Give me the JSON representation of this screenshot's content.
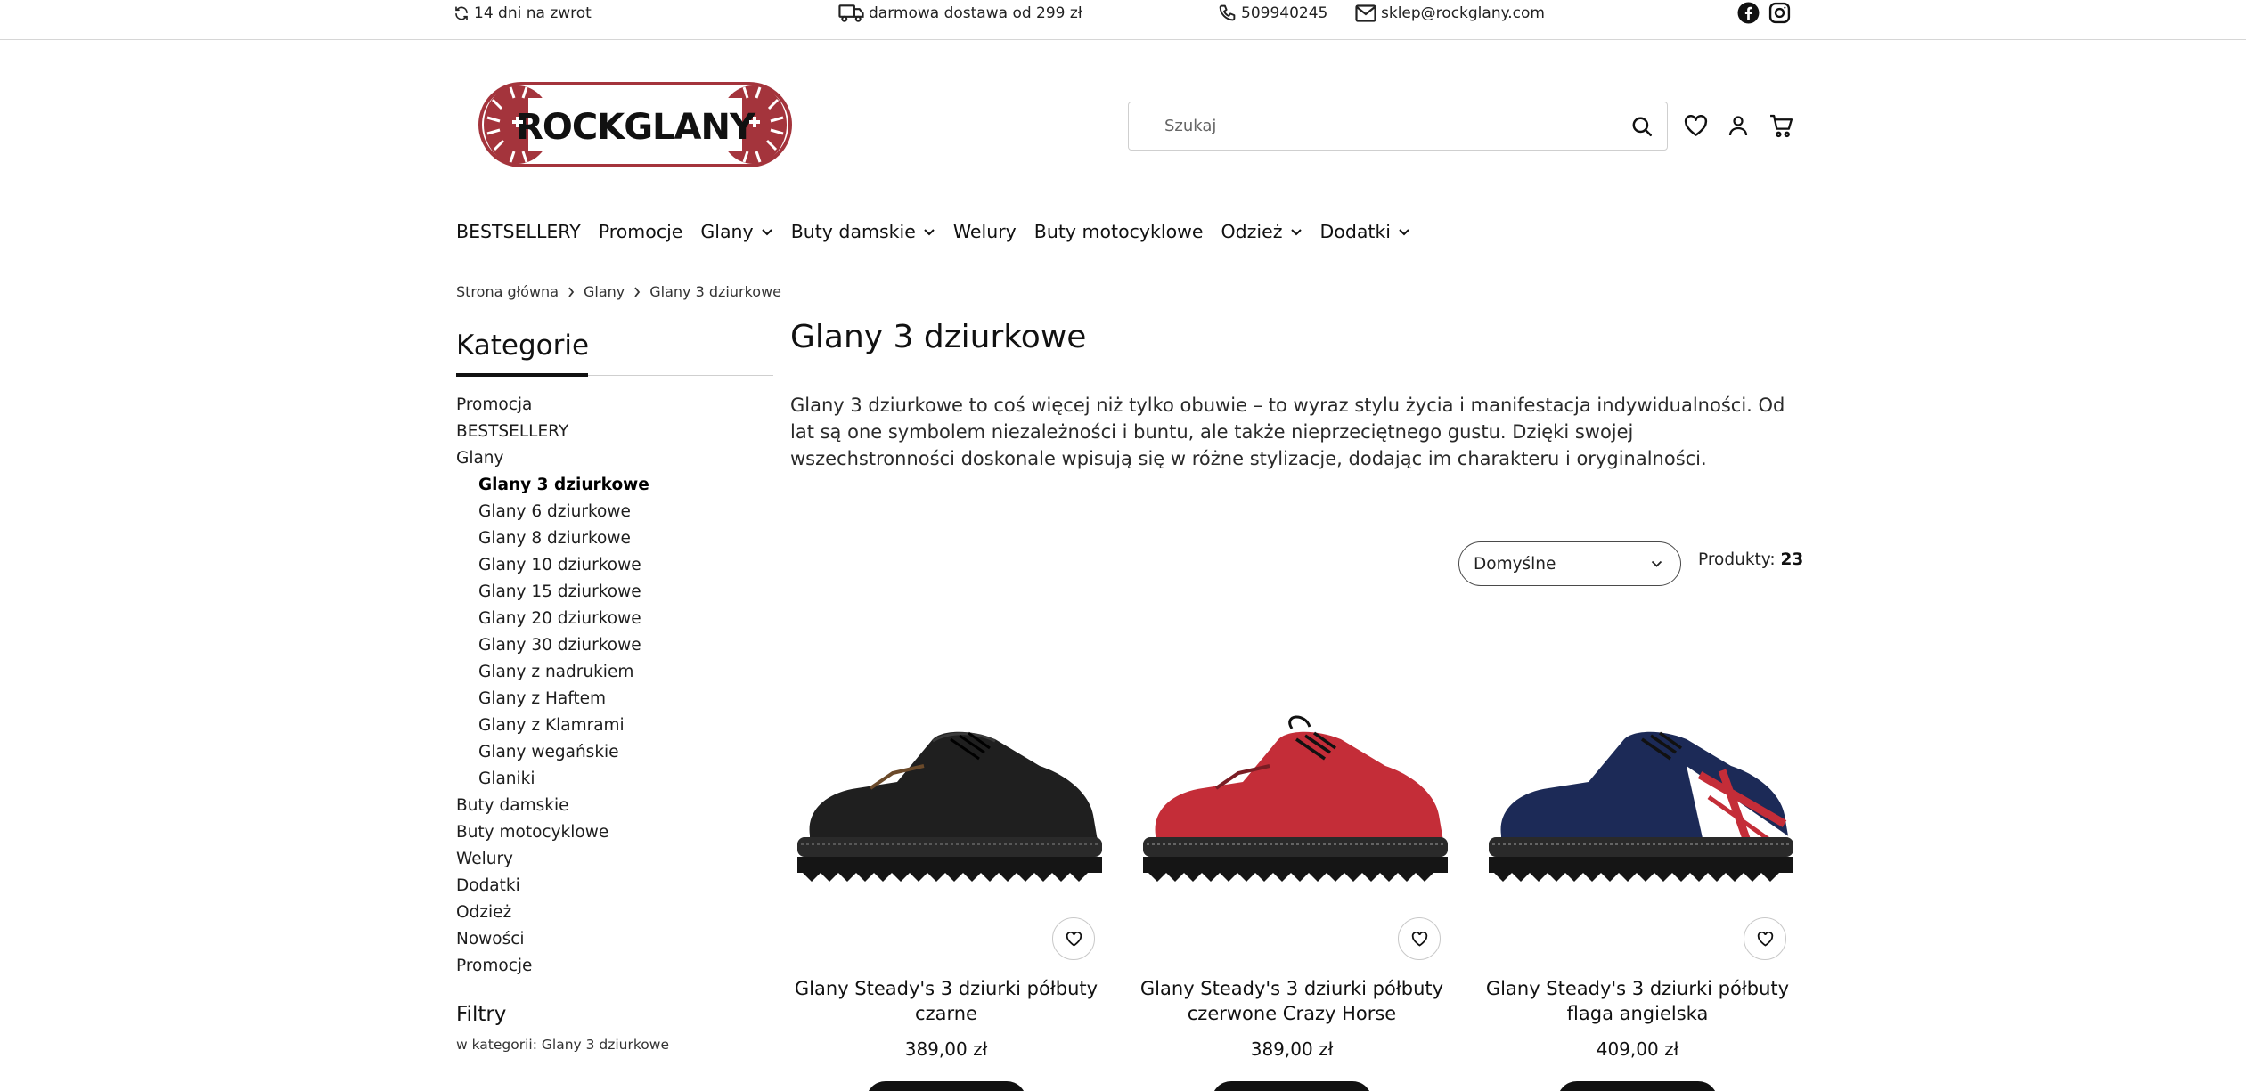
{
  "topbar": {
    "returns": "14 dni na zwrot",
    "shipping": "darmowa dostawa od 299 zł",
    "phone": "509940245",
    "email": "sklep@rockglany.com"
  },
  "logo": {
    "text": "ROCKGLANY"
  },
  "search": {
    "placeholder": "Szukaj"
  },
  "nav": {
    "items": [
      {
        "label": "BESTSELLERY",
        "dropdown": false
      },
      {
        "label": "Promocje",
        "dropdown": false
      },
      {
        "label": "Glany",
        "dropdown": true
      },
      {
        "label": "Buty damskie",
        "dropdown": true
      },
      {
        "label": "Welury",
        "dropdown": false
      },
      {
        "label": "Buty motocyklowe",
        "dropdown": false
      },
      {
        "label": "Odzież",
        "dropdown": true
      },
      {
        "label": "Dodatki",
        "dropdown": true
      }
    ]
  },
  "breadcrumb": [
    "Strona główna",
    "Glany",
    "Glany 3 dziurkowe"
  ],
  "sidebar": {
    "title": "Kategorie",
    "categories": [
      {
        "label": "Promocja"
      },
      {
        "label": "BESTSELLERY"
      },
      {
        "label": "Glany"
      },
      {
        "label": "Glany 3 dziurkowe"
      },
      {
        "label": "Glany 6 dziurkowe"
      },
      {
        "label": "Glany 8 dziurkowe"
      },
      {
        "label": "Glany 10 dziurkowe"
      },
      {
        "label": "Glany 15 dziurkowe"
      },
      {
        "label": "Glany 20 dziurkowe"
      },
      {
        "label": "Glany 30 dziurkowe"
      },
      {
        "label": "Glany z nadrukiem"
      },
      {
        "label": "Glany z Haftem"
      },
      {
        "label": "Glany z Klamrami"
      },
      {
        "label": "Glany wegańskie"
      },
      {
        "label": "Glaniki"
      },
      {
        "label": "Buty damskie"
      },
      {
        "label": "Buty motocyklowe"
      },
      {
        "label": "Welury"
      },
      {
        "label": "Dodatki"
      },
      {
        "label": "Odzież"
      },
      {
        "label": "Nowości"
      },
      {
        "label": "Promocje"
      }
    ],
    "filters_title": "Filtry",
    "filters_sub": "w kategorii: Glany 3 dziurkowe"
  },
  "main": {
    "title": "Glany 3 dziurkowe",
    "description": "Glany 3 dziurkowe to coś więcej niż tylko obuwie – to wyraz stylu życia i manifestacja indywidualności. Od lat są one symbolem niezależności i buntu, ale także nieprzeciętnego gustu. Dzięki swojej wszechstronności doskonale wpisują się w różne stylizacje, dodając im charakteru i oryginalności.",
    "sort_value": "Domyślne",
    "count_label": "Produkty:",
    "count_value": "23"
  },
  "products": [
    {
      "name": "Glany Steady's 3 dziurki półbuty czarne",
      "price": "389,00 zł",
      "color": "#1f1f1f"
    },
    {
      "name": "Glany Steady's 3 dziurki półbuty czerwone Crazy Horse",
      "price": "389,00 zł",
      "color": "#c42d38"
    },
    {
      "name": "Glany Steady's 3 dziurki półbuty flaga angielska",
      "price": "409,00 zł",
      "color": "#1c2a57"
    }
  ],
  "colors": {
    "brand_red": "#a4343c",
    "text": "#111111",
    "border": "#cfcfcf"
  }
}
